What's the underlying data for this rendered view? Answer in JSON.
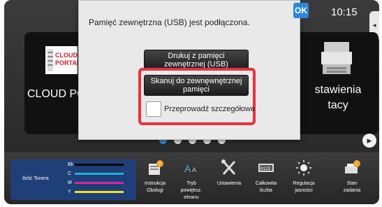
{
  "header": {
    "clock": "10:15"
  },
  "tiles": {
    "left_label": "CLOUD POR",
    "logo_line1": "CLOUD",
    "logo_line2": "PORTAL",
    "right_label_1": "stawienia",
    "right_label_2": "tacy"
  },
  "dialog": {
    "message": "Pamięć zewnętrzna (USB) jest podłączona.",
    "ok_label": "OK",
    "print_label_1": "Drukuj z pamięci",
    "print_label_2": "zewnętrznej (USB)",
    "scan_label_1": "Skanuj do zewnęwnętrznej",
    "scan_label_2": "pamięci",
    "details_label": "Przeprowadź szczegółowe",
    "highlight_color": "#e6333f"
  },
  "pager": {
    "count": 5,
    "active_index": 0
  },
  "bottom_bar": {
    "toner": {
      "title": "Ilość Tonera",
      "rows": [
        {
          "label": "Bk",
          "color": "#000000"
        },
        {
          "label": "C",
          "color": "#18b4d8"
        },
        {
          "label": "M",
          "color": "#d9259b"
        },
        {
          "label": "Y",
          "color": "#f2e21a"
        }
      ]
    },
    "items": [
      {
        "label_1": "Instrukcja",
        "label_2": "Obsługi",
        "label_3": ""
      },
      {
        "label_1": "Tryb",
        "label_2": "powiększ.",
        "label_3": "ekranu"
      },
      {
        "label_1": "Ustawienia",
        "label_2": "",
        "label_3": ""
      },
      {
        "label_1": "Całkowita",
        "label_2": "liczba",
        "label_3": ""
      },
      {
        "label_1": "Regulacja",
        "label_2": "jasności",
        "label_3": ""
      },
      {
        "label_1": "Stan",
        "label_2": "zadania",
        "label_3": ""
      }
    ]
  }
}
